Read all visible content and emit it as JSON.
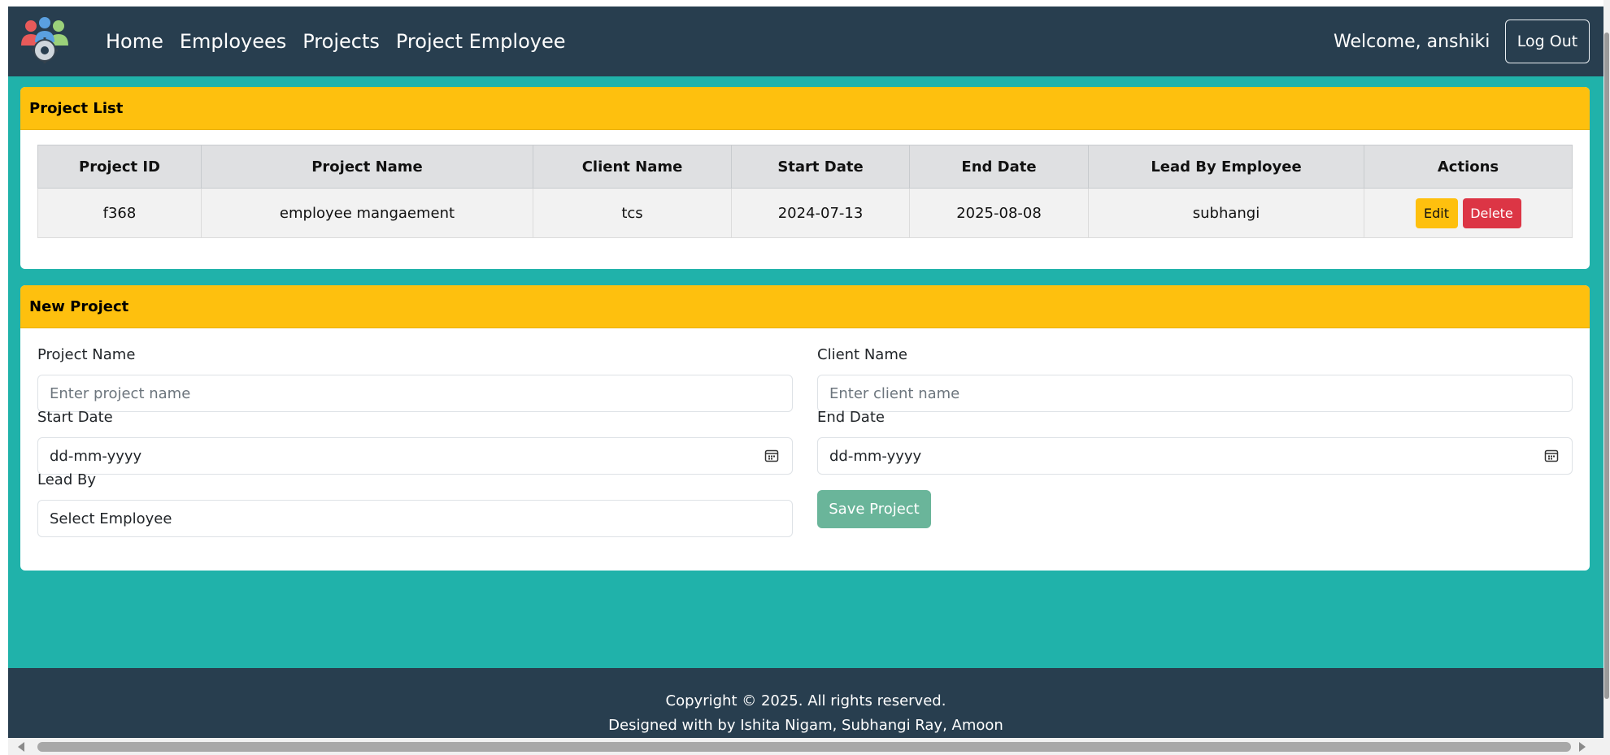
{
  "nav": {
    "links": [
      "Home",
      "Employees",
      "Projects",
      "Project Employee"
    ],
    "welcome": "Welcome, anshiki",
    "logout_label": "Log Out"
  },
  "project_list": {
    "title": "Project List",
    "columns": [
      "Project ID",
      "Project Name",
      "Client Name",
      "Start Date",
      "End Date",
      "Lead By Employee",
      "Actions"
    ],
    "rows": [
      {
        "id": "f368",
        "name": "employee mangaement",
        "client": "tcs",
        "start": "2024-07-13",
        "end": "2025-08-08",
        "lead": "subhangi"
      }
    ],
    "edit_label": "Edit",
    "delete_label": "Delete"
  },
  "new_project": {
    "title": "New Project",
    "project_name_label": "Project Name",
    "project_name_placeholder": "Enter project name",
    "client_name_label": "Client Name",
    "client_name_placeholder": "Enter client name",
    "start_date_label": "Start Date",
    "start_date_value": "dd-mm-yyyy",
    "end_date_label": "End Date",
    "end_date_value": "dd-mm-yyyy",
    "lead_by_label": "Lead By",
    "lead_by_value": "Select Employee",
    "save_label": "Save Project"
  },
  "footer": {
    "copyright": "Copyright © 2025. All rights reserved.",
    "credits": "Designed with by Ishita Nigam, Subhangi Ray, Amoon"
  },
  "colors": {
    "navbar": "#283e4f",
    "background": "#20b2aa",
    "card_header": "#fec00e",
    "save_button": "#6ab59a",
    "delete_button": "#dc3545"
  }
}
